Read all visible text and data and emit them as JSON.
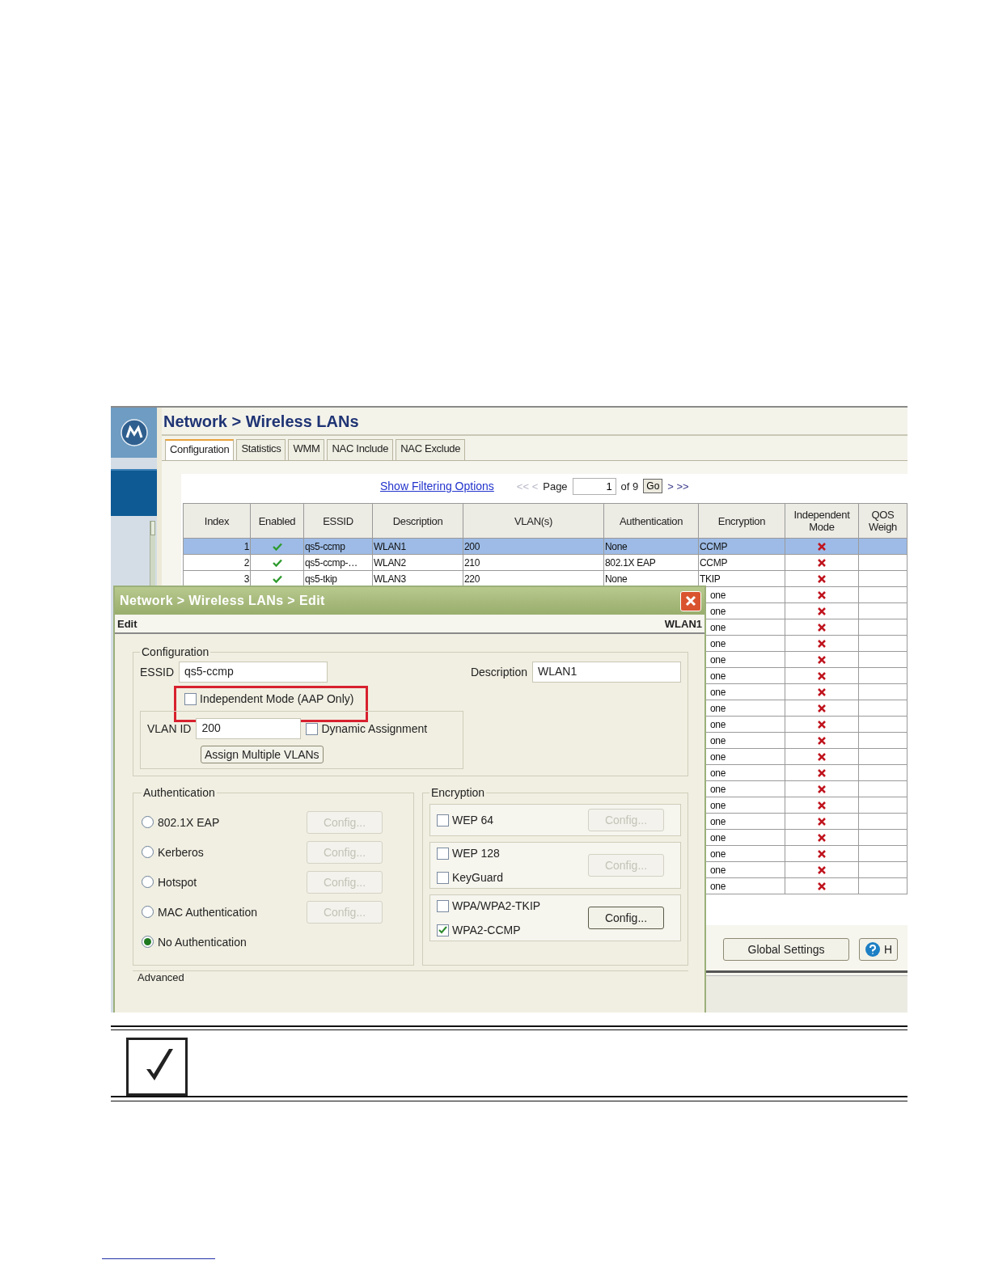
{
  "main": {
    "title": "Network > Wireless LANs",
    "tabs": [
      {
        "label": "Configuration",
        "selected": true
      },
      {
        "label": "Statistics",
        "selected": false
      },
      {
        "label": "WMM",
        "selected": false
      },
      {
        "label": "NAC Include",
        "selected": false
      },
      {
        "label": "NAC Exclude",
        "selected": false
      }
    ],
    "filter_link": "Show Filtering Options",
    "pager": {
      "prev": "<< <",
      "prev_disabled": true,
      "page_label": "Page",
      "page_value": "1",
      "of": "of 9",
      "go": "Go",
      "next": "> >>"
    },
    "columns": [
      "Index",
      "Enabled",
      "ESSID",
      "Description",
      "VLAN(s)",
      "Authentication",
      "Encryption",
      "Independent Mode",
      "QOS Weigh"
    ],
    "rows": [
      {
        "kind": "full",
        "index": "1",
        "enabled": true,
        "essid": "qs5-ccmp",
        "description": "WLAN1",
        "vlans": "200",
        "authentication": "None",
        "encryption": "CCMP",
        "independent_mode": false,
        "selected": true
      },
      {
        "kind": "full",
        "index": "2",
        "enabled": true,
        "essid": "qs5-ccmp-…",
        "description": "WLAN2",
        "vlans": "210",
        "authentication": "802.1X EAP",
        "encryption": "CCMP",
        "independent_mode": false,
        "selected": false
      },
      {
        "kind": "full",
        "index": "3",
        "enabled": true,
        "essid": "qs5-tkip",
        "description": "WLAN3",
        "vlans": "220",
        "authentication": "None",
        "encryption": "TKIP",
        "independent_mode": false,
        "selected": false
      },
      {
        "kind": "covered",
        "encryption": "one",
        "independent_mode": false
      },
      {
        "kind": "covered",
        "encryption": "one",
        "independent_mode": false
      },
      {
        "kind": "covered",
        "encryption": "one",
        "independent_mode": false
      },
      {
        "kind": "covered",
        "encryption": "one",
        "independent_mode": false
      },
      {
        "kind": "covered",
        "encryption": "one",
        "independent_mode": false
      },
      {
        "kind": "covered",
        "encryption": "one",
        "independent_mode": false
      },
      {
        "kind": "covered",
        "encryption": "one",
        "independent_mode": false
      },
      {
        "kind": "covered",
        "encryption": "one",
        "independent_mode": false
      },
      {
        "kind": "covered",
        "encryption": "one",
        "independent_mode": false
      },
      {
        "kind": "covered",
        "encryption": "one",
        "independent_mode": false
      },
      {
        "kind": "covered",
        "encryption": "one",
        "independent_mode": false
      },
      {
        "kind": "covered",
        "encryption": "one",
        "independent_mode": false
      },
      {
        "kind": "covered",
        "encryption": "one",
        "independent_mode": false
      },
      {
        "kind": "covered",
        "encryption": "one",
        "independent_mode": false
      },
      {
        "kind": "covered",
        "encryption": "one",
        "independent_mode": false
      },
      {
        "kind": "covered",
        "encryption": "one",
        "independent_mode": false
      },
      {
        "kind": "covered",
        "encryption": "one",
        "independent_mode": false
      },
      {
        "kind": "covered",
        "encryption": "one",
        "independent_mode": false
      },
      {
        "kind": "covered",
        "encryption": "one",
        "independent_mode": false
      }
    ],
    "global_settings": "Global Settings",
    "help": "H"
  },
  "dialog": {
    "title": "Network > Wireless LANs > Edit",
    "heading": "Edit",
    "record": "WLAN1",
    "configuration": {
      "legend": "Configuration",
      "essid_label": "ESSID",
      "essid_value": "qs5-ccmp",
      "description_label": "Description",
      "description_value": "WLAN1",
      "independent_mode": {
        "label": "Independent Mode (AAP Only)",
        "checked": false,
        "highlighted": true
      },
      "vlan_label": "VLAN ID",
      "vlan_value": "200",
      "dynamic_assignment": {
        "label": "Dynamic Assignment",
        "checked": false
      },
      "assign_button": "Assign Multiple VLANs"
    },
    "authentication": {
      "legend": "Authentication",
      "options": [
        {
          "label": "802.1X EAP",
          "selected": false,
          "config": "Config...",
          "config_disabled": true
        },
        {
          "label": "Kerberos",
          "selected": false,
          "config": "Config...",
          "config_disabled": true
        },
        {
          "label": "Hotspot",
          "selected": false,
          "config": "Config...",
          "config_disabled": true
        },
        {
          "label": "MAC Authentication",
          "selected": false,
          "config": "Config...",
          "config_disabled": true
        },
        {
          "label": "No Authentication",
          "selected": true
        }
      ]
    },
    "encryption": {
      "legend": "Encryption",
      "groups": [
        {
          "options": [
            {
              "label": "WEP 64",
              "checked": false
            }
          ],
          "config": "Config...",
          "config_disabled": true
        },
        {
          "options": [
            {
              "label": "WEP 128",
              "checked": false
            },
            {
              "label": "KeyGuard",
              "checked": false
            }
          ],
          "config": "Config...",
          "config_disabled": true
        },
        {
          "options": [
            {
              "label": "WPA/WPA2-TKIP",
              "checked": false
            },
            {
              "label": "WPA2-CCMP",
              "checked": true
            }
          ],
          "config": "Config...",
          "config_disabled": false
        }
      ]
    },
    "advanced_legend": "Advanced"
  }
}
